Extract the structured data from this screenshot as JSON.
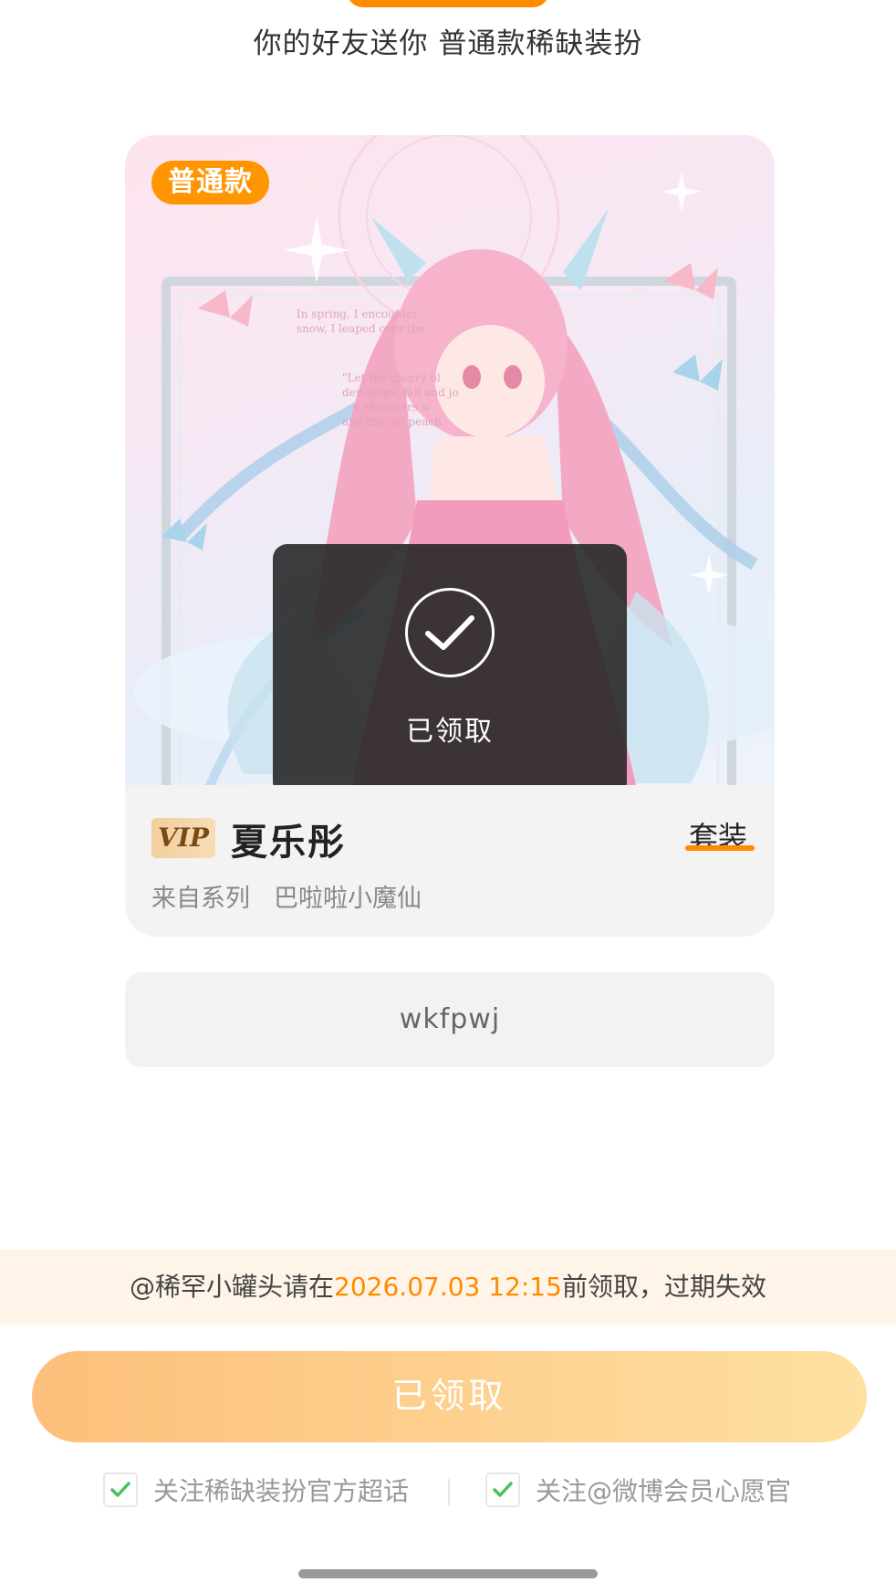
{
  "page": {
    "title": "你的好友送你 普通款稀缺装扮"
  },
  "item": {
    "type_badge": "普通款",
    "vip_label": "VIP",
    "name": "夏乐彤",
    "type": "套装",
    "series_label": "来自系列",
    "series_name": "巴啦啦小魔仙",
    "art_text": [
      "In spring, I encounter",
      "snow, I leaped over the",
      "\"Let the cherry bl",
      "dewdrops, fall and jo",
      "n shimmers w",
      "and the old peach"
    ]
  },
  "overlay": {
    "status": "已领取",
    "icon": "checkmark-icon"
  },
  "code": {
    "value": "wkfpwj"
  },
  "notice": {
    "prefix": "@稀罕小罐头请在",
    "deadline": "2026.07.03 12:15",
    "suffix": "前领取，过期失效"
  },
  "claim_button": {
    "label": "已领取"
  },
  "follow_options": [
    {
      "label": "关注稀缺装扮官方超话",
      "checked": true
    },
    {
      "label": "关注@微博会员心愿官",
      "checked": true
    }
  ],
  "colors": {
    "accent": "#ff8a00",
    "badge": "#ff9500",
    "check": "#4cc05a",
    "button_start": "#fdbf7b",
    "button_end": "#fee0a0",
    "notice_bg": "#fff4e8"
  }
}
